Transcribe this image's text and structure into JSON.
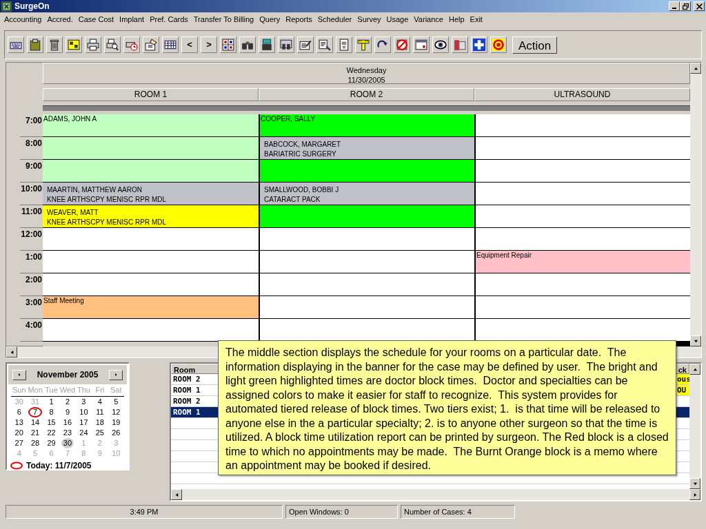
{
  "window": {
    "title": "SurgeOn"
  },
  "menu": [
    "Accounting",
    "Accred.",
    "Case Cost",
    "Implant",
    "Pref. Cards",
    "Transfer To Billing",
    "Query",
    "Reports",
    "Scheduler",
    "Survey",
    "Usage",
    "Variance",
    "Help",
    "Exit"
  ],
  "toolbar": {
    "nav_buttons": [
      "<",
      ">"
    ],
    "action_button": "Action"
  },
  "schedule": {
    "day": "Wednesday",
    "date": "11/30/2005",
    "times": [
      "7:00",
      "8:00",
      "9:00",
      "10:00",
      "11:00",
      "12:00",
      "1:00",
      "2:00",
      "3:00",
      "4:00"
    ],
    "rooms": [
      {
        "name": "ROOM 1",
        "slots": [
          {
            "color": "#c0ffc0",
            "kind": "block",
            "lines": [
              "ADAMS, JOHN A"
            ]
          },
          {
            "color": "#c0ffc0"
          },
          {
            "color": "#c0ffc0"
          },
          {
            "color": "#c0c0c8",
            "kind": "case",
            "lines": [
              "MAARTIN, MATTHEW AARON",
              "KNEE ARTHSCPY MENISC RPR MDL"
            ]
          },
          {
            "color": "#ffff00",
            "kind": "case",
            "lines": [
              "WEAVER, MATT",
              "KNEE ARTHSCPY MENISC RPR MDL"
            ]
          },
          {
            "color": "#ffffff"
          },
          {
            "color": "#ffffff"
          },
          {
            "color": "#ffffff"
          },
          {
            "color": "#ffc080",
            "kind": "block",
            "lines": [
              "Staff Meeting"
            ]
          },
          {
            "color": "#ffffff"
          }
        ]
      },
      {
        "name": "ROOM 2",
        "slots": [
          {
            "color": "#00ff00",
            "kind": "block",
            "lines": [
              "COOPER, SALLY"
            ]
          },
          {
            "color": "#c0c0c8",
            "kind": "case",
            "lines": [
              "BABCOCK, MARGARET",
              "BARIATRIC SURGERY"
            ]
          },
          {
            "color": "#00ff00"
          },
          {
            "color": "#c0c0c8",
            "kind": "case",
            "lines": [
              "SMALLWOOD, BOBBI J",
              "CATARACT PACK"
            ]
          },
          {
            "color": "#00ff00"
          },
          {
            "color": "#ffffff"
          },
          {
            "color": "#ffffff"
          },
          {
            "color": "#ffffff"
          },
          {
            "color": "#ffffff"
          },
          {
            "color": "#ffffff"
          }
        ]
      },
      {
        "name": "ULTRASOUND",
        "slots": [
          {
            "color": "#ffffff"
          },
          {
            "color": "#ffffff"
          },
          {
            "color": "#ffffff"
          },
          {
            "color": "#ffffff"
          },
          {
            "color": "#ffffff"
          },
          {
            "color": "#ffffff"
          },
          {
            "color": "#ffc0c8",
            "kind": "block",
            "lines": [
              "Equipment Repair"
            ]
          },
          {
            "color": "#ffffff"
          },
          {
            "color": "#ffffff"
          },
          {
            "color": "#ffffff"
          }
        ]
      }
    ]
  },
  "calendar": {
    "month": "November 2005",
    "weekdays": [
      "Sun",
      "Mon",
      "Tue",
      "Wed",
      "Thu",
      "Fri",
      "Sat"
    ],
    "today_label": "Today: 11/7/2005",
    "weeks": [
      [
        {
          "day": "30",
          "muted": true,
          "today": false,
          "selected": false
        },
        {
          "day": "31",
          "muted": true,
          "today": false,
          "selected": false
        },
        {
          "day": "1",
          "muted": false,
          "today": false,
          "selected": false
        },
        {
          "day": "2",
          "muted": false,
          "today": false,
          "selected": false
        },
        {
          "day": "3",
          "muted": false,
          "today": false,
          "selected": false
        },
        {
          "day": "4",
          "muted": false,
          "today": false,
          "selected": false
        },
        {
          "day": "5",
          "muted": false,
          "today": false,
          "selected": false
        }
      ],
      [
        {
          "day": "6",
          "muted": false,
          "today": false,
          "selected": false
        },
        {
          "day": "7",
          "muted": false,
          "today": true,
          "selected": false
        },
        {
          "day": "8",
          "muted": false,
          "today": false,
          "selected": false
        },
        {
          "day": "9",
          "muted": false,
          "today": false,
          "selected": false
        },
        {
          "day": "10",
          "muted": false,
          "today": false,
          "selected": false
        },
        {
          "day": "11",
          "muted": false,
          "today": false,
          "selected": false
        },
        {
          "day": "12",
          "muted": false,
          "today": false,
          "selected": false
        }
      ],
      [
        {
          "day": "13",
          "muted": false,
          "today": false,
          "selected": false
        },
        {
          "day": "14",
          "muted": false,
          "today": false,
          "selected": false
        },
        {
          "day": "15",
          "muted": false,
          "today": false,
          "selected": false
        },
        {
          "day": "16",
          "muted": false,
          "today": false,
          "selected": false
        },
        {
          "day": "17",
          "muted": false,
          "today": false,
          "selected": false
        },
        {
          "day": "18",
          "muted": false,
          "today": false,
          "selected": false
        },
        {
          "day": "19",
          "muted": false,
          "today": false,
          "selected": false
        }
      ],
      [
        {
          "day": "20",
          "muted": false,
          "today": false,
          "selected": false
        },
        {
          "day": "21",
          "muted": false,
          "today": false,
          "selected": false
        },
        {
          "day": "22",
          "muted": false,
          "today": false,
          "selected": false
        },
        {
          "day": "23",
          "muted": false,
          "today": false,
          "selected": false
        },
        {
          "day": "24",
          "muted": false,
          "today": false,
          "selected": false
        },
        {
          "day": "25",
          "muted": false,
          "today": false,
          "selected": false
        },
        {
          "day": "26",
          "muted": false,
          "today": false,
          "selected": false
        }
      ],
      [
        {
          "day": "27",
          "muted": false,
          "today": false,
          "selected": false
        },
        {
          "day": "28",
          "muted": false,
          "today": false,
          "selected": false
        },
        {
          "day": "29",
          "muted": false,
          "today": false,
          "selected": false
        },
        {
          "day": "30",
          "muted": false,
          "today": false,
          "selected": true
        },
        {
          "day": "1",
          "muted": true,
          "today": false,
          "selected": false
        },
        {
          "day": "2",
          "muted": true,
          "today": false,
          "selected": false
        },
        {
          "day": "3",
          "muted": true,
          "today": false,
          "selected": false
        }
      ],
      [
        {
          "day": "4",
          "muted": true,
          "today": false,
          "selected": false
        },
        {
          "day": "5",
          "muted": true,
          "today": false,
          "selected": false
        },
        {
          "day": "6",
          "muted": true,
          "today": false,
          "selected": false
        },
        {
          "day": "7",
          "muted": true,
          "today": false,
          "selected": false
        },
        {
          "day": "8",
          "muted": true,
          "today": false,
          "selected": false
        },
        {
          "day": "9",
          "muted": true,
          "today": false,
          "selected": false
        },
        {
          "day": "10",
          "muted": true,
          "today": false,
          "selected": false
        }
      ]
    ]
  },
  "case_list": {
    "columns": [
      "Room",
      "ck"
    ],
    "rows": [
      {
        "room": "ROOM 2",
        "column_2": "ous",
        "highlighted": true,
        "selected": false
      },
      {
        "room": "ROOM 1",
        "column_2": "OU",
        "highlighted": true,
        "selected": false
      },
      {
        "room": "ROOM 2",
        "highlighted": false,
        "selected": false
      },
      {
        "room": "ROOM 1",
        "highlighted": false,
        "selected": true
      }
    ]
  },
  "callout": {
    "text": "The middle section displays the schedule for your rooms on a particular date.  The information displaying in the banner for the case may be defined by user.  The bright and light green highlighted times are doctor block times.  Doctor and specialties can be assigned colors to make it easier for staff to recognize.  This system provides for automated tiered release of block times. Two tiers exist; 1.  is that time will be released to anyone else in the a particular specialty; 2. is to anyone other surgeon so that the time is utilized. A block time utilization report can be printed by surgeon. The Red block is a closed time to which no appointments may be made.  The Burnt Orange block is a memo where an appointment may be booked if desired."
  },
  "status_bar": [
    "3:49 PM",
    "Open Windows: 0",
    "Number of Cases: 4"
  ]
}
